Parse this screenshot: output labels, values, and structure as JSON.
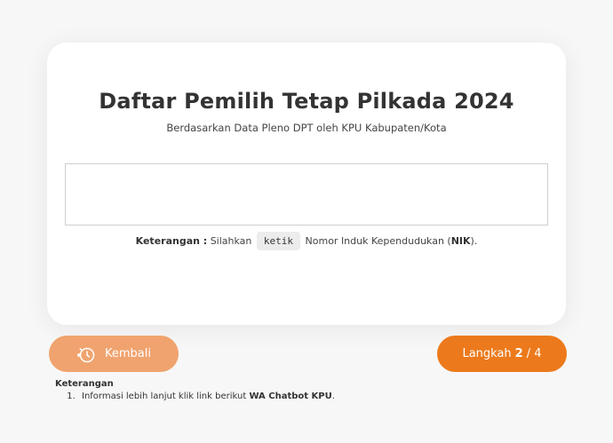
{
  "card": {
    "title": "Daftar Pemilih Tetap Pilkada 2024",
    "subtitle": "Berdasarkan Data Pleno DPT oleh KPU Kabupaten/Kota",
    "input_value": "",
    "note": {
      "label": "Keterangan :",
      "text_before": "Silahkan",
      "code": "ketik",
      "text_after": "Nomor Induk Kependudukan (",
      "abbr": "NIK",
      "text_end": ")."
    }
  },
  "nav": {
    "back_label": "Kembali",
    "back_icon": "history-clock-icon",
    "step_prefix": "Langkah",
    "step_current": "2",
    "step_separator": "/",
    "step_total": "4"
  },
  "footer": {
    "title": "Keterangan",
    "items": [
      {
        "text": "Informasi lebih lanjut klik link berikut",
        "link": "WA Chatbot KPU",
        "suffix": "."
      }
    ]
  },
  "colors": {
    "primary": "#ec7a1c",
    "primary_light": "#f0a36e",
    "background": "#f7f7f7"
  }
}
